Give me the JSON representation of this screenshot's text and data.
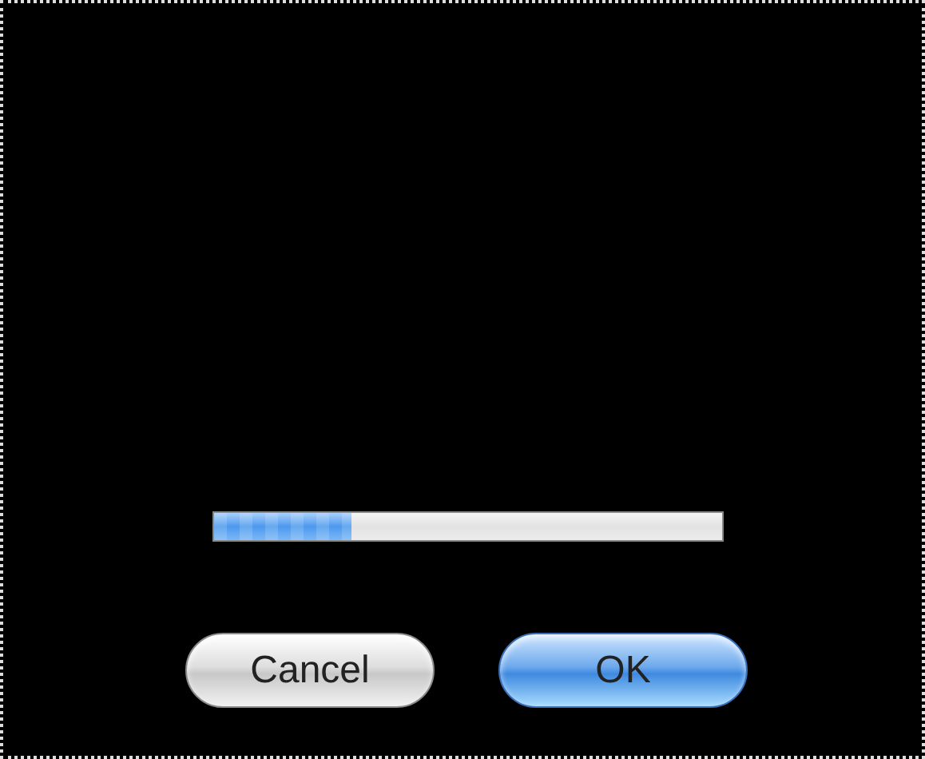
{
  "progress": {
    "level": 0.27
  },
  "buttons": [
    {
      "label": "Cancel",
      "default": false
    },
    {
      "label": "OK",
      "default": true
    }
  ]
}
